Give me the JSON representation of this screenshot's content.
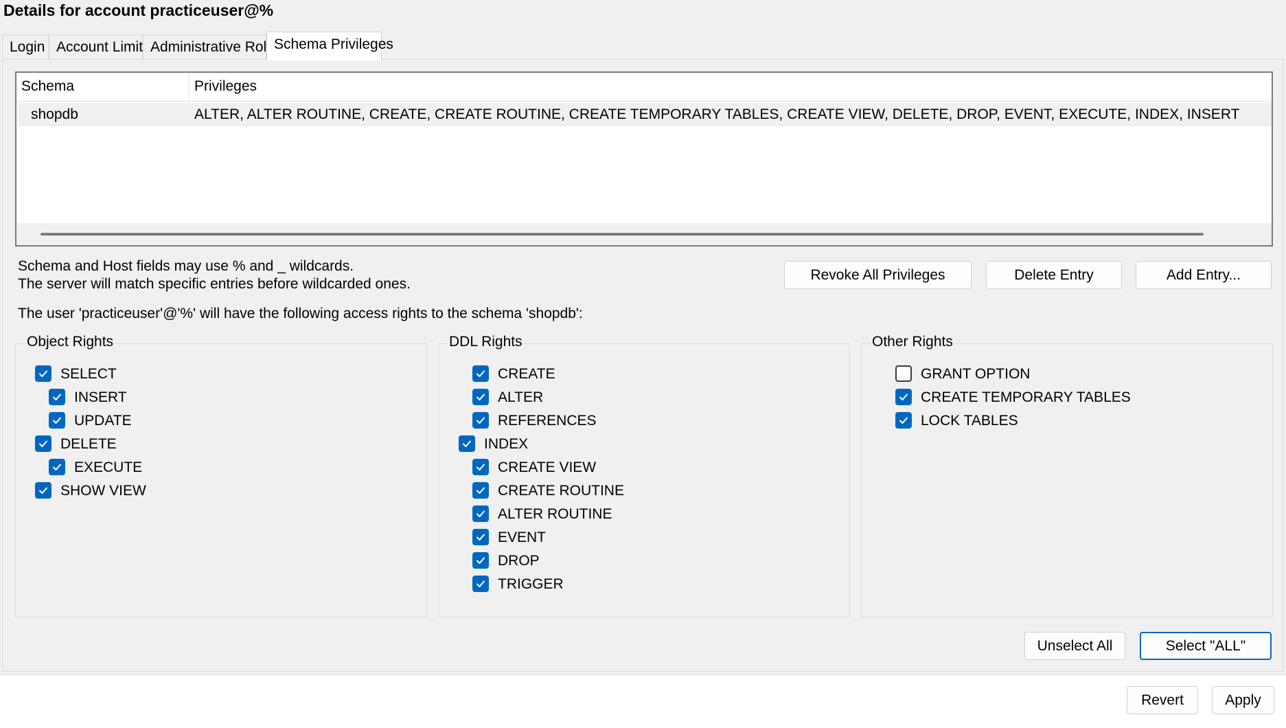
{
  "header": {
    "title": "Details for account practiceuser@%"
  },
  "tabs": [
    {
      "label": "Login",
      "active": false
    },
    {
      "label": "Account Limits",
      "active": false
    },
    {
      "label": "Administrative Roles",
      "active": false
    },
    {
      "label": "Schema Privileges",
      "active": true
    }
  ],
  "grid": {
    "columns": [
      "Schema",
      "Privileges"
    ],
    "rows": [
      {
        "schema": "shopdb",
        "privileges": "ALTER, ALTER ROUTINE, CREATE, CREATE ROUTINE, CREATE TEMPORARY TABLES, CREATE VIEW, DELETE, DROP, EVENT, EXECUTE, INDEX, INSERT"
      }
    ]
  },
  "info": {
    "line1": "Schema and Host fields may use % and _ wildcards.",
    "line2": "The server will match specific entries before wildcarded ones.",
    "access_line": "The user 'practiceuser'@'%' will have the following access rights to the schema 'shopdb':"
  },
  "buttons": {
    "revoke_all": "Revoke All Privileges",
    "delete_entry": "Delete Entry",
    "add_entry": "Add Entry...",
    "unselect_all": "Unselect All",
    "select_all": "Select \"ALL\"",
    "revert": "Revert",
    "apply": "Apply"
  },
  "groups": {
    "object_rights": {
      "title": "Object Rights",
      "items": [
        {
          "label": "SELECT",
          "checked": true
        },
        {
          "label": "INSERT",
          "checked": true
        },
        {
          "label": "UPDATE",
          "checked": true
        },
        {
          "label": "DELETE",
          "checked": true
        },
        {
          "label": "EXECUTE",
          "checked": true
        },
        {
          "label": "SHOW VIEW",
          "checked": true
        }
      ]
    },
    "ddl_rights": {
      "title": "DDL Rights",
      "items": [
        {
          "label": "CREATE",
          "checked": true
        },
        {
          "label": "ALTER",
          "checked": true
        },
        {
          "label": "REFERENCES",
          "checked": true
        },
        {
          "label": "INDEX",
          "checked": true
        },
        {
          "label": "CREATE VIEW",
          "checked": true
        },
        {
          "label": "CREATE ROUTINE",
          "checked": true
        },
        {
          "label": "ALTER ROUTINE",
          "checked": true
        },
        {
          "label": "EVENT",
          "checked": true
        },
        {
          "label": "DROP",
          "checked": true
        },
        {
          "label": "TRIGGER",
          "checked": true
        }
      ]
    },
    "other_rights": {
      "title": "Other Rights",
      "items": [
        {
          "label": "GRANT OPTION",
          "checked": false
        },
        {
          "label": "CREATE TEMPORARY TABLES",
          "checked": true
        },
        {
          "label": "LOCK TABLES",
          "checked": true
        }
      ]
    }
  },
  "colors": {
    "accent": "#0067c0",
    "panel_bg": "#f0f0f0",
    "border": "#d9d9d9"
  }
}
